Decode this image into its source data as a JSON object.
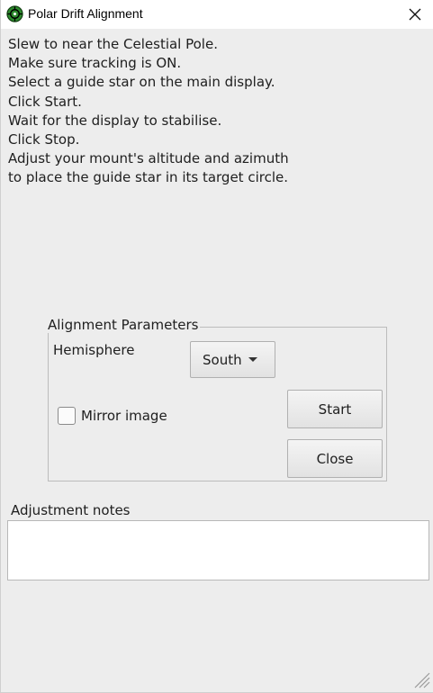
{
  "window": {
    "title": "Polar Drift Alignment",
    "icon": "compass-target-icon",
    "close_icon": "close-icon"
  },
  "instructions": [
    "Slew to near the Celestial Pole.",
    "Make sure tracking is ON.",
    "Select a guide star on the main display.",
    "Click Start.",
    "Wait for the display to stabilise.",
    "Click Stop.",
    "Adjust your mount's altitude and azimuth",
    "to place the guide star in its target circle."
  ],
  "alignment": {
    "group_title": "Alignment Parameters",
    "hemisphere_label": "Hemisphere",
    "hemisphere_value": "South",
    "mirror_label": "Mirror image",
    "mirror_checked": false,
    "start_label": "Start",
    "close_label": "Close"
  },
  "notes": {
    "label": "Adjustment notes",
    "value": ""
  },
  "colors": {
    "background": "#ededed",
    "icon_green": "#2e8b2e"
  }
}
